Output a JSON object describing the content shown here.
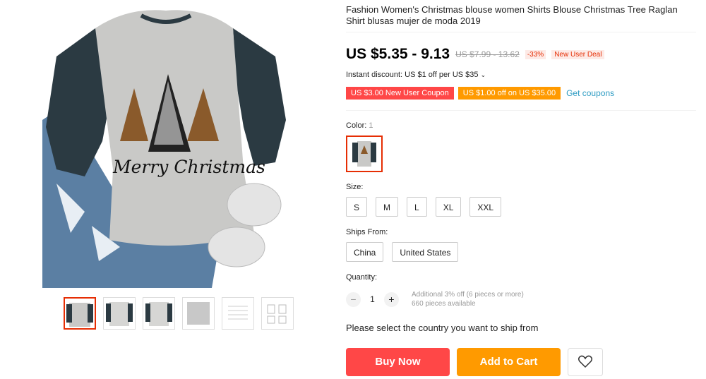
{
  "product": {
    "title": "Fashion Women's Christmas blouse women Shirts Blouse Christmas Tree Raglan Shirt blusas mujer de moda 2019",
    "price": "US $5.35 - 9.13",
    "original_price": "US $7.99 - 13.62",
    "discount_pct": "-33%",
    "new_user_deal": "New User Deal",
    "instant_discount": "Instant discount: US $1 off per US $35",
    "image_text": "Merry Christmas"
  },
  "coupons": {
    "new_user": "US $3.00 New User Coupon",
    "store": "US $1.00 off on US $35.00",
    "get_coupons": "Get coupons"
  },
  "color": {
    "label": "Color:",
    "count": "1"
  },
  "size": {
    "label": "Size:",
    "options": [
      "S",
      "M",
      "L",
      "XL",
      "XXL"
    ]
  },
  "ships_from": {
    "label": "Ships From:",
    "options": [
      "China",
      "United States"
    ]
  },
  "quantity": {
    "label": "Quantity:",
    "minus": "−",
    "plus": "+",
    "value": "1",
    "note_offer": "Additional 3% off (6 pieces or more)",
    "note_available": "660 pieces available"
  },
  "ship_message": "Please select the country you want to ship from",
  "actions": {
    "buy_now": "Buy Now",
    "add_to_cart": "Add to Cart"
  },
  "colors": {
    "accent_red": "#ff4747",
    "accent_orange": "#ff9a00",
    "link_blue": "#2e9cc3",
    "sleeve": "#2b3a42",
    "body_grey": "#c9c9c7"
  },
  "icons": {
    "wishlist": "heart-icon"
  }
}
